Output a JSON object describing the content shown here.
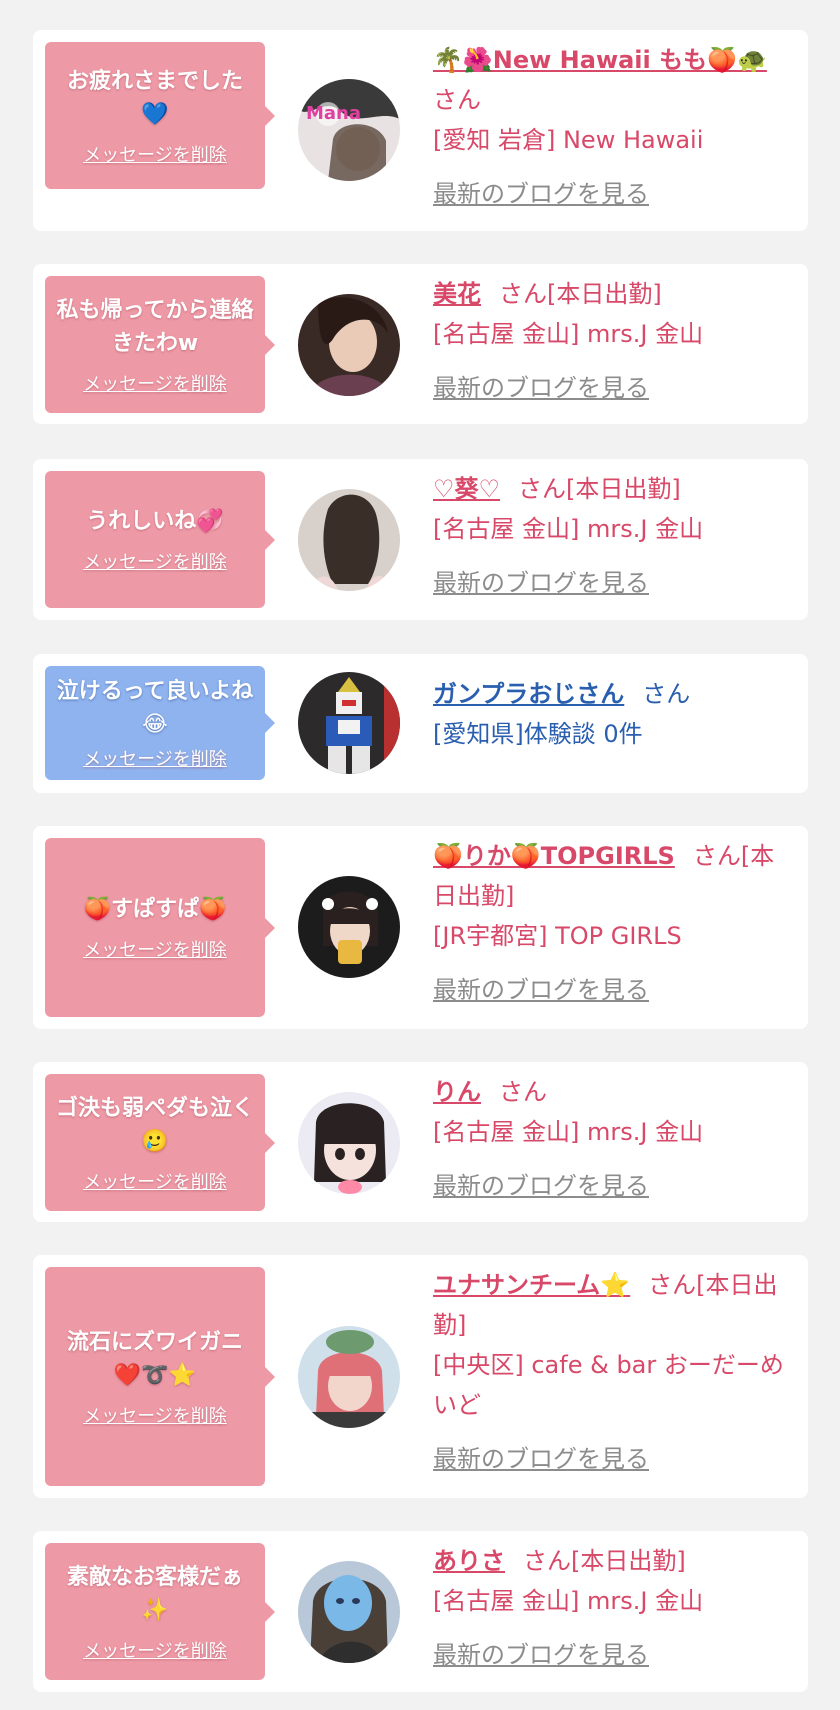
{
  "blog_link_label": "最新のブログを見る",
  "delete_label": "メッセージを削除",
  "colors": {
    "card_bg": "#ffffff",
    "page_bg": "#f2f2f2",
    "bubble_pink": "#ee9aa6",
    "bubble_blue": "#8fb3ee",
    "name_pink": "#d84868",
    "name_blue": "#2a5fb0",
    "blog_gray": "#8c8c8c"
  },
  "items": [
    {
      "message": "お疲れさまでした💙",
      "name": "🌴🌺New Hawaii もも🍑🐢",
      "suffix": "さん",
      "shop": "[愛知 岩倉] New Hawaii"
    },
    {
      "message": "私も帰ってから連絡きたわw",
      "name": "美花",
      "suffix": "さん[本日出勤]",
      "shop": "[名古屋 金山] mrs.J 金山"
    },
    {
      "message": "うれしいね💞",
      "name": "♡葵♡",
      "suffix": "さん[本日出勤]",
      "shop": "[名古屋 金山] mrs.J 金山"
    },
    {
      "message": "泣けるって良いよね😂",
      "name": "ガンプラおじさん",
      "suffix": "さん",
      "shop": "[愛知県]体験談 0件"
    },
    {
      "message": "🍑すぱすぱ🍑",
      "name": "🍑りか🍑TOPGIRLS",
      "suffix": "さん[本日出勤]",
      "shop": "[JR宇都宮] TOP GIRLS"
    },
    {
      "message": "ゴ決も弱ペダも泣く🥲",
      "name": "りん",
      "suffix": "さん",
      "shop": "[名古屋 金山] mrs.J 金山"
    },
    {
      "message": "流石にズワイガニ❤️➰⭐",
      "name": "ユナサンチーム⭐",
      "suffix": "さん[本日出勤]",
      "shop": "[中央区] cafe & bar おーだーめいど"
    },
    {
      "message": "素敵なお客様だぁ✨",
      "name": "ありさ",
      "suffix": "さん[本日出勤]",
      "shop": "[名古屋 金山] mrs.J 金山"
    }
  ]
}
